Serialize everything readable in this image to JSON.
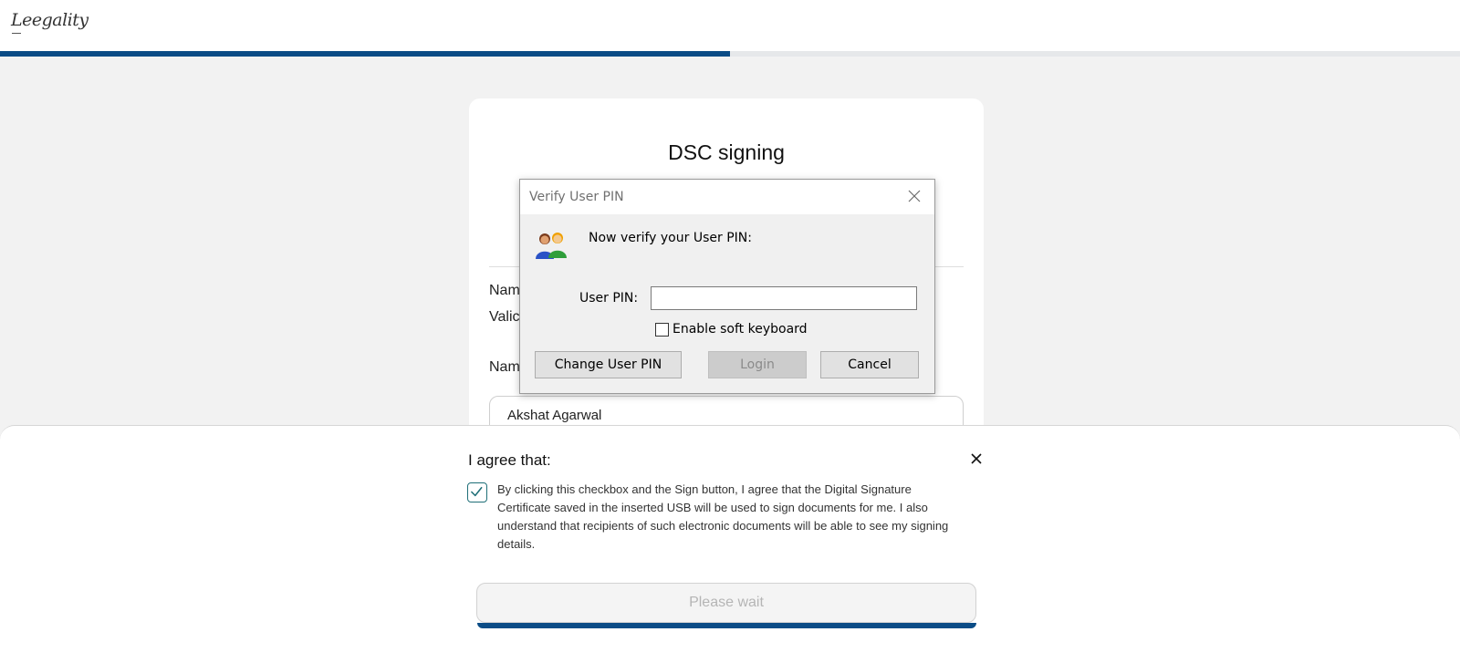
{
  "header": {
    "logo_text": "Leegality",
    "progress_percent": 50
  },
  "card": {
    "title": "DSC signing",
    "row1_label": "Nam",
    "row2_label": "Valic",
    "name_label": "Nam",
    "name_value": "Akshat Agarwal"
  },
  "dialog": {
    "title": "Verify User PIN",
    "prompt": "Now verify your User PIN:",
    "pin_label": "User PIN:",
    "pin_value": "",
    "soft_keyboard_label": "Enable soft keyboard",
    "soft_keyboard_checked": false,
    "change_pin_label": "Change User PIN",
    "login_label": "Login",
    "cancel_label": "Cancel"
  },
  "consent": {
    "title": "I agree that:",
    "checked": true,
    "text": "By clicking this checkbox and the Sign button, I agree that the Digital Signature Certificate saved in the inserted USB will be used to sign documents for me. I also understand that recipients of such electronic documents will be able to see my signing details.",
    "button_label": "Please wait"
  },
  "colors": {
    "brand_blue": "#0b4c86",
    "check_teal": "#1f6f78"
  },
  "icons": {
    "dialog_close": "close-icon",
    "users": "users-icon",
    "consent_close": "close-icon",
    "consent_check": "checkmark-icon"
  }
}
